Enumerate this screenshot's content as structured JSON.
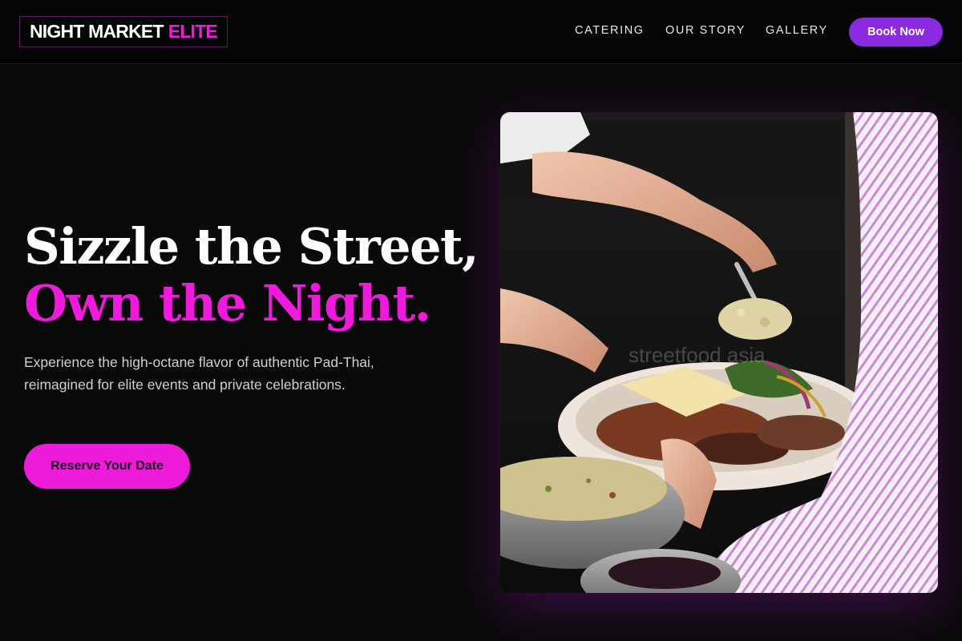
{
  "brand": {
    "name": "NIGHT MARKET",
    "accent": "ELITE"
  },
  "nav": {
    "links": [
      {
        "label": "CATERING"
      },
      {
        "label": "OUR STORY"
      },
      {
        "label": "GALLERY"
      }
    ],
    "book_label": "Book Now"
  },
  "hero": {
    "headline_line1": "Sizzle the Street,",
    "headline_line2": "Own the Night.",
    "subtext": "Experience the high-octane flavor of authentic Pad-Thai, reimagined for elite events and private celebrations.",
    "cta_label": "Reserve Your Date",
    "photo_watermark": "streetfood asia"
  },
  "colors": {
    "accent": "#ee1bdc",
    "button_purple": "#8a2be2",
    "background": "#0a0a0a"
  }
}
